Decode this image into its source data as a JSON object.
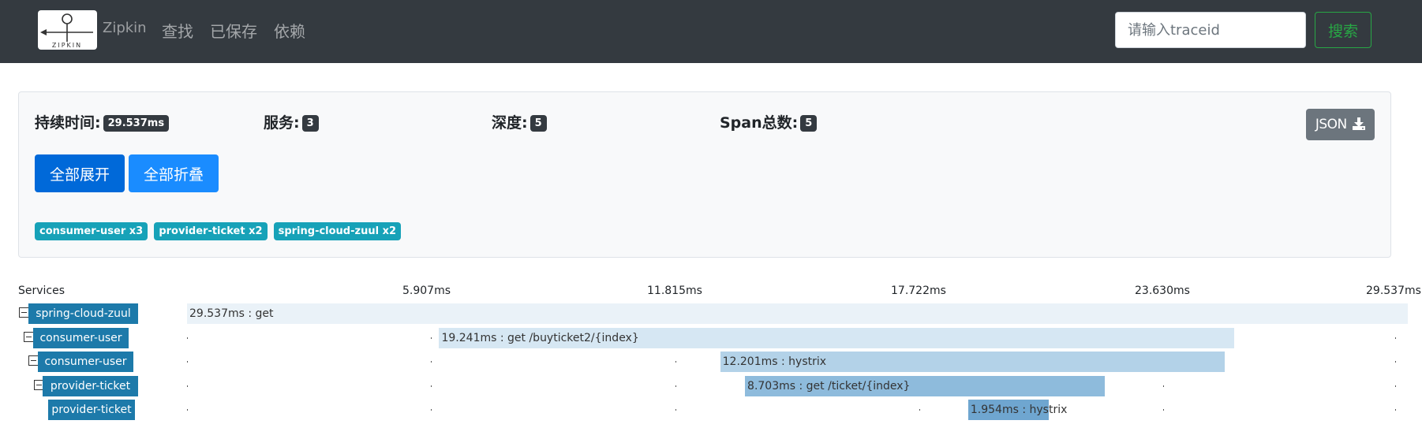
{
  "navbar": {
    "brand": "Zipkin",
    "logo_text": "ZIPKIN",
    "nav_links": [
      "查找",
      "已保存",
      "依赖"
    ],
    "search_placeholder": "请输入traceid",
    "search_button": "搜索"
  },
  "summary": {
    "duration_label": "持续时间:",
    "duration_value": "29.537ms",
    "services_label": "服务:",
    "services_value": "3",
    "depth_label": "深度:",
    "depth_value": "5",
    "span_total_label": "Span总数:",
    "span_total_value": "5",
    "json_button": "JSON",
    "json_icon": "download-icon",
    "expand_all": "全部展开",
    "collapse_all": "全部折叠",
    "service_tags": [
      "consumer-user x3",
      "provider-ticket x2",
      "spring-cloud-zuul x2"
    ]
  },
  "timeline": {
    "services_header": "Services",
    "ticks": [
      "5.907ms",
      "11.815ms",
      "17.722ms",
      "23.630ms",
      "29.537ms"
    ],
    "rows": [
      {
        "service": "spring-cloud-zuul",
        "label": "29.537ms : get",
        "start_ms": 0,
        "duration_ms": 29.537,
        "has_toggle": true
      },
      {
        "service": "consumer-user",
        "label": "19.241ms : get /buyticket2/{index}",
        "start_ms": 6.1,
        "duration_ms": 19.241,
        "has_toggle": true
      },
      {
        "service": "consumer-user",
        "label": "12.201ms : hystrix",
        "start_ms": 12.9,
        "duration_ms": 12.201,
        "has_toggle": true
      },
      {
        "service": "provider-ticket",
        "label": "8.703ms : get /ticket/{index}",
        "start_ms": 13.5,
        "duration_ms": 8.703,
        "has_toggle": true
      },
      {
        "service": "provider-ticket",
        "label": "1.954ms : hystrix",
        "start_ms": 18.9,
        "duration_ms": 1.954,
        "has_toggle": false
      }
    ],
    "total_ms": 29.537
  },
  "colors": {
    "navbar_bg": "#343a40",
    "primary": "#0069d9",
    "info": "#17a2b8",
    "success": "#28a745",
    "service_label_bg": "#1d7aaa",
    "span_shades": [
      "#eaf2f8",
      "#d6e7f3",
      "#b3d2e8",
      "#8ebbdc",
      "#6fa6d0"
    ]
  }
}
